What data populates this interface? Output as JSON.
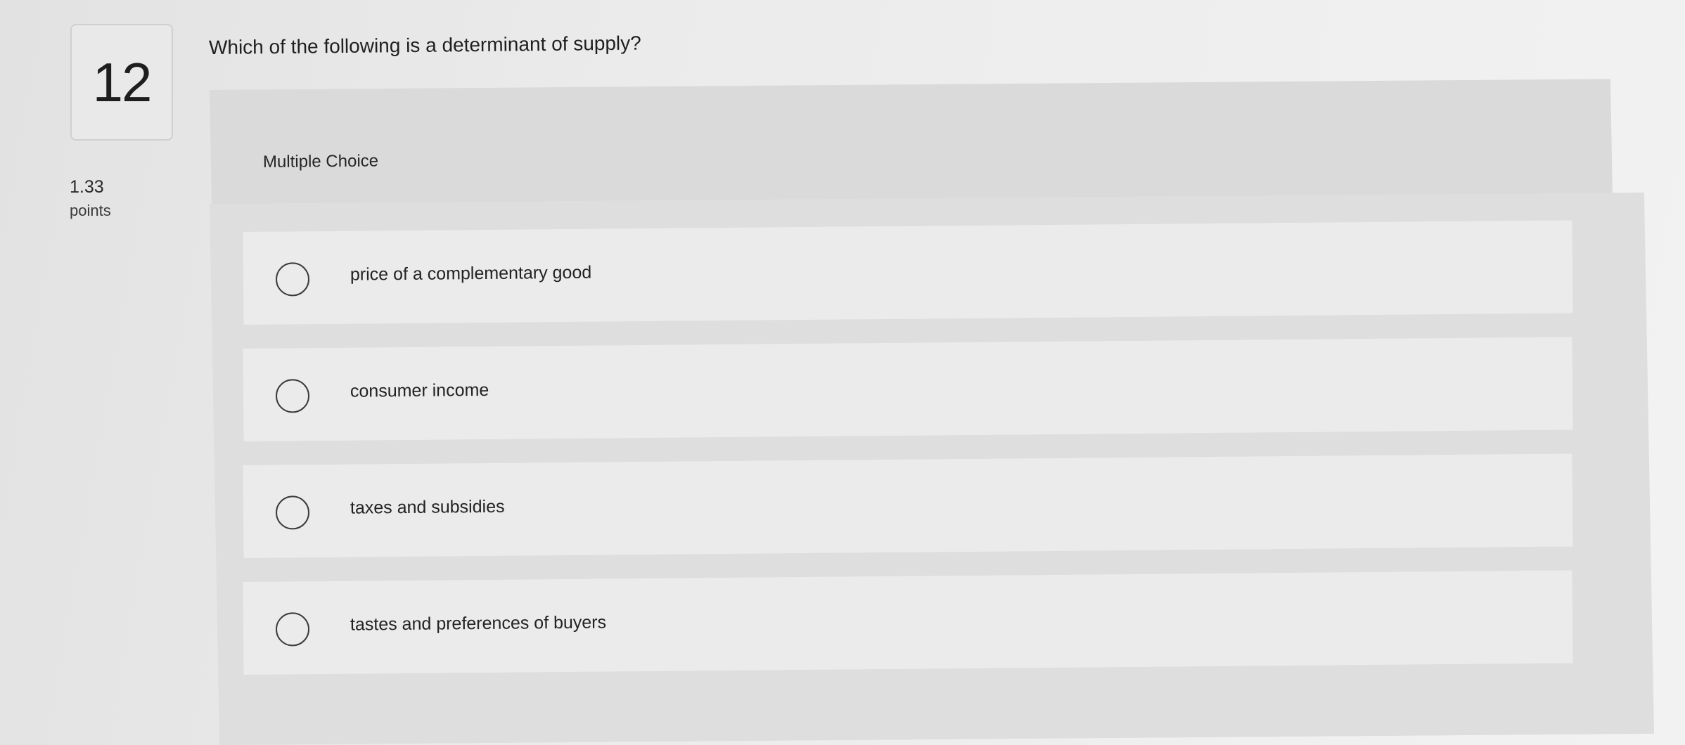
{
  "question_number": "12",
  "points": {
    "value": "1.33",
    "label": "points"
  },
  "question_text": "Which of the following is a determinant of supply?",
  "question_type": "Multiple Choice",
  "choices": [
    {
      "label": "price of a complementary good",
      "selected": false
    },
    {
      "label": "consumer income",
      "selected": false
    },
    {
      "label": "taxes and subsidies",
      "selected": false
    },
    {
      "label": "tastes and preferences of buyers",
      "selected": false
    }
  ]
}
